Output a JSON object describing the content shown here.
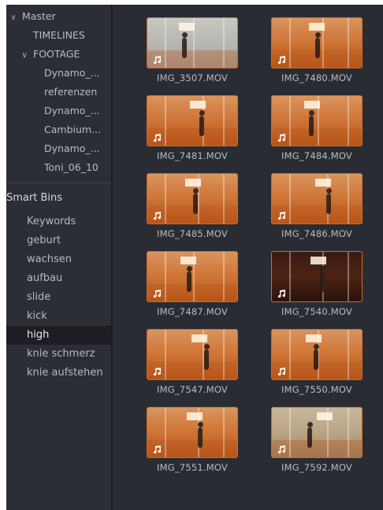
{
  "sidebar": {
    "tree": [
      {
        "label": "Master",
        "expanded": true,
        "level": 0
      },
      {
        "label": "TIMELINES",
        "expanded": null,
        "level": 1
      },
      {
        "label": "FOOTAGE",
        "expanded": true,
        "level": 1
      },
      {
        "label": "Dynamo_...",
        "expanded": null,
        "level": 2
      },
      {
        "label": "referenzen",
        "expanded": null,
        "level": 2
      },
      {
        "label": "Dynamo_...",
        "expanded": null,
        "level": 2
      },
      {
        "label": "Cambium...",
        "expanded": null,
        "level": 2
      },
      {
        "label": "Dynamo_...",
        "expanded": null,
        "level": 2
      },
      {
        "label": "Toni_06_10",
        "expanded": null,
        "level": 2
      }
    ],
    "smart_bins_title": "Smart Bins",
    "smart_bins": [
      "Keywords",
      "geburt",
      "wachsen",
      "aufbau",
      "slide",
      "kick",
      "high",
      "knie schmerz",
      "knie aufstehen"
    ],
    "selected_smart_bin": "high"
  },
  "clips": [
    {
      "name": "IMG_3507.MOV",
      "tone": "gray"
    },
    {
      "name": "IMG_7480.MOV",
      "tone": "orange"
    },
    {
      "name": "IMG_7481.MOV",
      "tone": "orange"
    },
    {
      "name": "IMG_7484.MOV",
      "tone": "orange"
    },
    {
      "name": "IMG_7485.MOV",
      "tone": "orange"
    },
    {
      "name": "IMG_7486.MOV",
      "tone": "orange"
    },
    {
      "name": "IMG_7487.MOV",
      "tone": "orange"
    },
    {
      "name": "IMG_7540.MOV",
      "tone": "dark"
    },
    {
      "name": "IMG_7547.MOV",
      "tone": "orange"
    },
    {
      "name": "IMG_7550.MOV",
      "tone": "orange"
    },
    {
      "name": "IMG_7551.MOV",
      "tone": "orange"
    },
    {
      "name": "IMG_7592.MOV",
      "tone": "tan"
    }
  ],
  "icons": {
    "chevron_expanded": "chevron-down-icon",
    "clip_audio": "music-note-icon"
  },
  "colors": {
    "clip_border": "#d66b24",
    "selected_bg": "#1d1e24",
    "panel_bg": "#2c2e36"
  }
}
